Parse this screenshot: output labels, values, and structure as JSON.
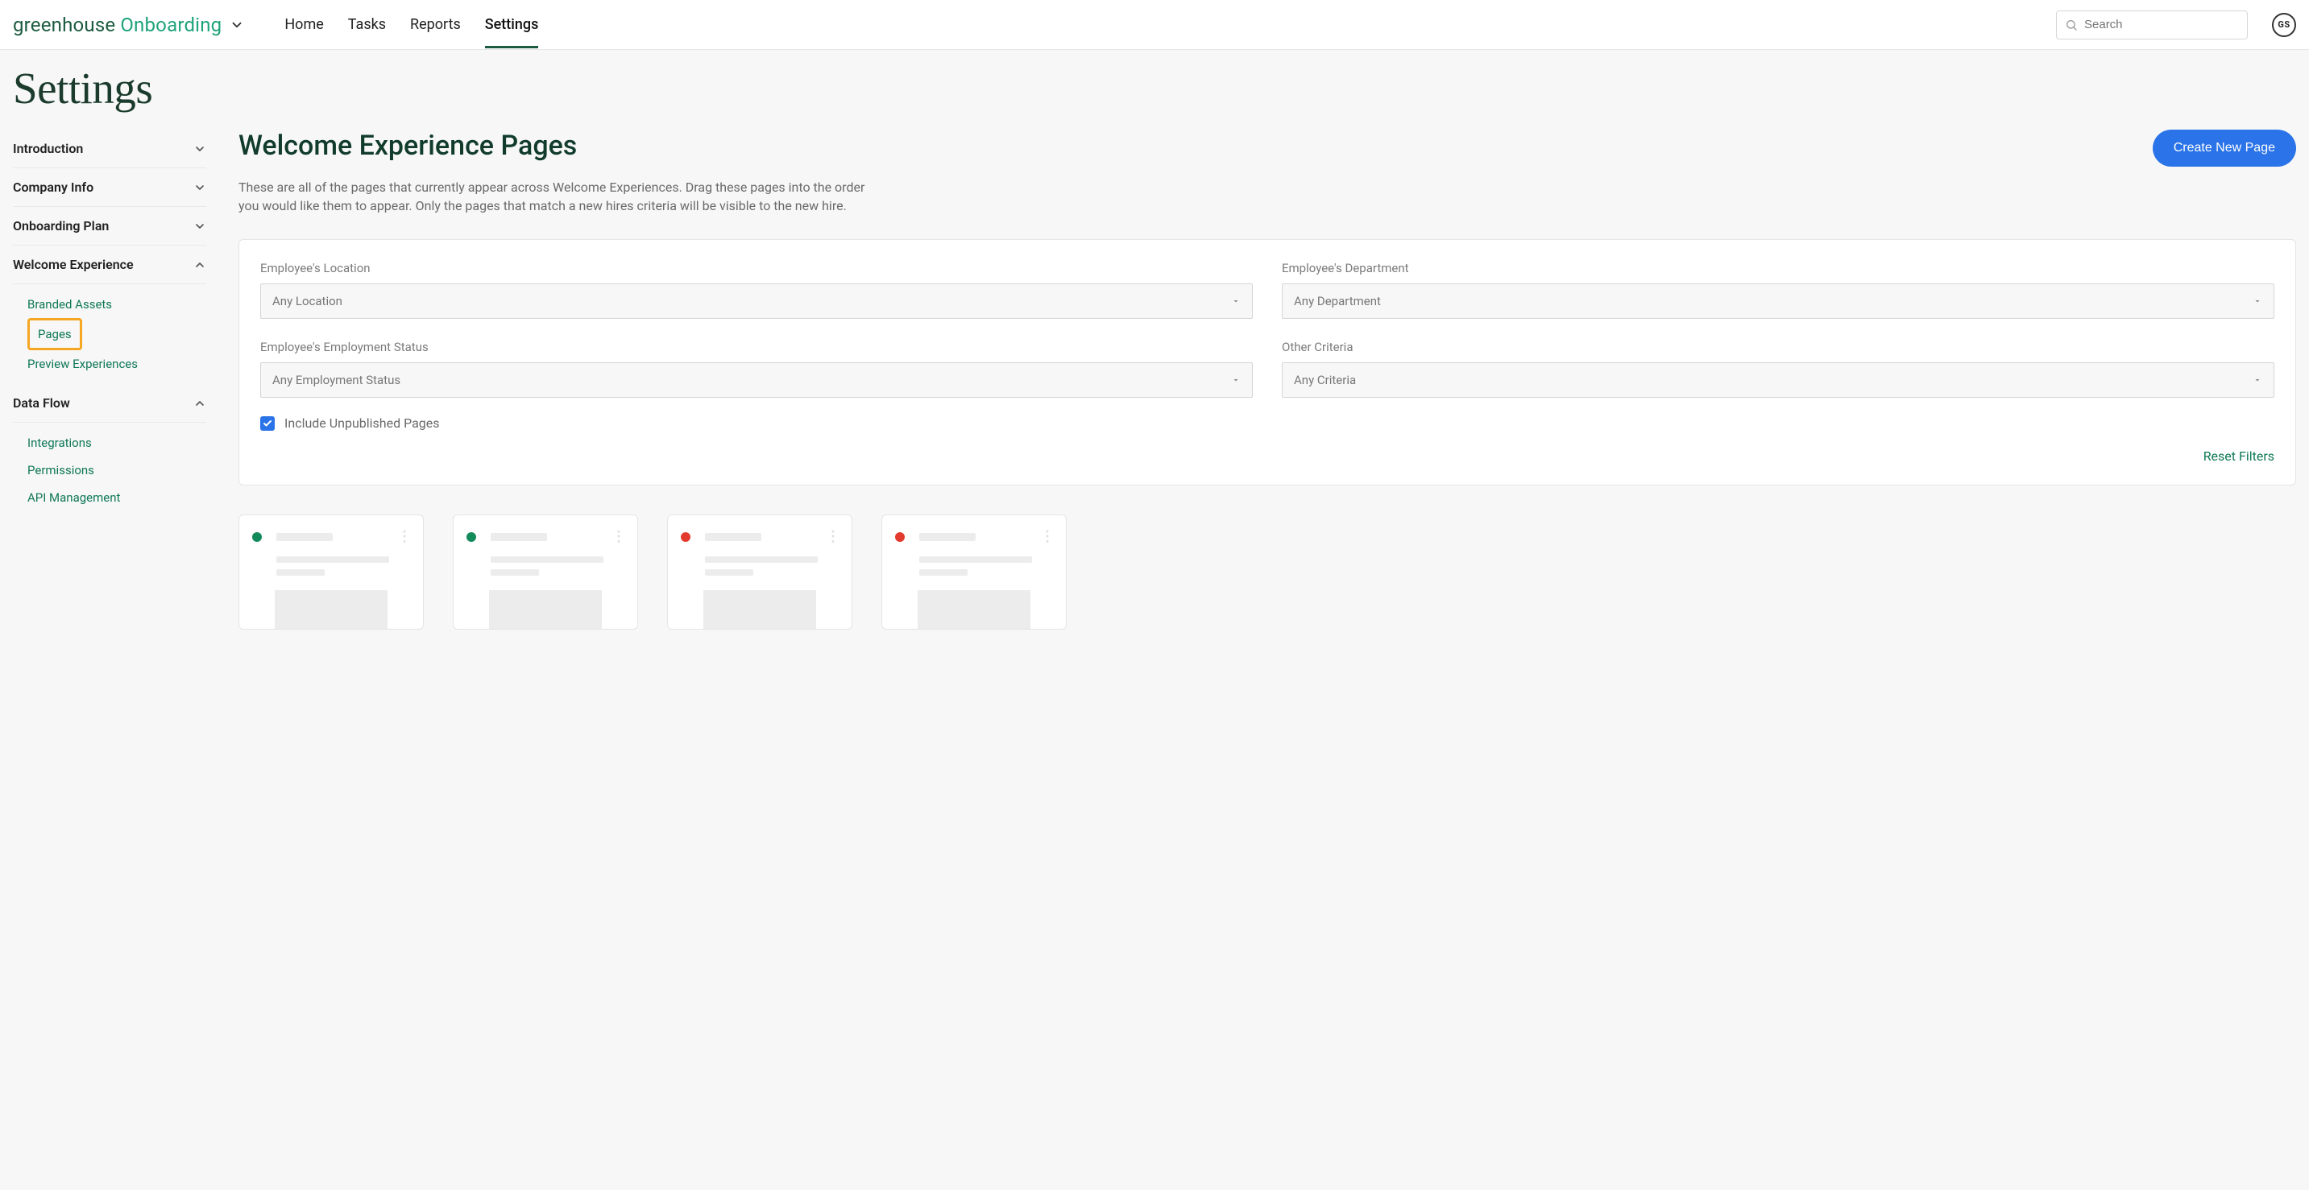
{
  "brand": {
    "word1": "greenhouse",
    "word2": "Onboarding"
  },
  "nav": {
    "items": [
      {
        "label": "Home",
        "active": false
      },
      {
        "label": "Tasks",
        "active": false
      },
      {
        "label": "Reports",
        "active": false
      },
      {
        "label": "Settings",
        "active": true
      }
    ]
  },
  "search": {
    "placeholder": "Search"
  },
  "avatar": {
    "initials": "GS"
  },
  "page": {
    "title": "Settings"
  },
  "sidebar": {
    "sections": [
      {
        "label": "Introduction",
        "expanded": false
      },
      {
        "label": "Company Info",
        "expanded": false
      },
      {
        "label": "Onboarding Plan",
        "expanded": false
      },
      {
        "label": "Welcome Experience",
        "expanded": true,
        "items": [
          {
            "label": "Branded Assets",
            "highlight": false
          },
          {
            "label": "Pages",
            "highlight": true
          },
          {
            "label": "Preview Experiences",
            "highlight": false
          }
        ]
      },
      {
        "label": "Data Flow",
        "expanded": true,
        "items": [
          {
            "label": "Integrations",
            "highlight": false
          },
          {
            "label": "Permissions",
            "highlight": false
          },
          {
            "label": "API Management",
            "highlight": false
          }
        ]
      }
    ]
  },
  "main": {
    "title": "Welcome Experience Pages",
    "create_label": "Create New Page",
    "description": "These are all of the pages that currently appear across Welcome Experiences. Drag these pages into the order you would like them to appear. Only the pages that match a new hires criteria will be visible to the new hire."
  },
  "filters": {
    "location": {
      "label": "Employee's Location",
      "value": "Any Location"
    },
    "department": {
      "label": "Employee's Department",
      "value": "Any Department"
    },
    "status": {
      "label": "Employee's Employment Status",
      "value": "Any Employment Status"
    },
    "other": {
      "label": "Other Criteria",
      "value": "Any Criteria"
    },
    "include_unpublished": {
      "label": "Include Unpublished Pages",
      "checked": true
    },
    "reset_label": "Reset Filters"
  },
  "cards": [
    {
      "status": "green"
    },
    {
      "status": "green"
    },
    {
      "status": "red"
    },
    {
      "status": "red"
    }
  ]
}
